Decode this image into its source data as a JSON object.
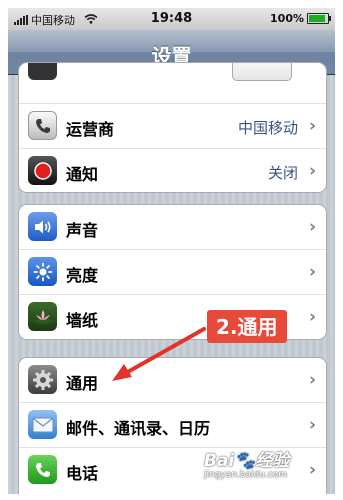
{
  "status_bar": {
    "carrier": "中国移动",
    "time": "19:48",
    "battery": "100%"
  },
  "nav": {
    "title": "设置"
  },
  "groups": [
    {
      "items": [
        {
          "label": "运营商",
          "value": "中国移动",
          "icon": "phone-carrier-icon"
        },
        {
          "label": "通知",
          "value": "关闭",
          "icon": "notifications-icon"
        }
      ]
    },
    {
      "items": [
        {
          "label": "声音",
          "icon": "sound-icon"
        },
        {
          "label": "亮度",
          "icon": "brightness-icon"
        },
        {
          "label": "墙纸",
          "icon": "wallpaper-icon"
        }
      ]
    },
    {
      "items": [
        {
          "label": "通用",
          "icon": "general-gear-icon"
        },
        {
          "label": "邮件、通讯录、日历",
          "icon": "mail-icon"
        },
        {
          "label": "电话",
          "icon": "phone-icon"
        }
      ]
    }
  ],
  "annotation": {
    "text": "2.通用",
    "color": "#e84a3a"
  },
  "watermark": {
    "logo": "Bai🐾经验",
    "url": "jingyan.baidu.com"
  },
  "colors": {
    "nav_bar": "#7a8da8",
    "value_text": "#385487",
    "background": "#c5ccd4"
  }
}
